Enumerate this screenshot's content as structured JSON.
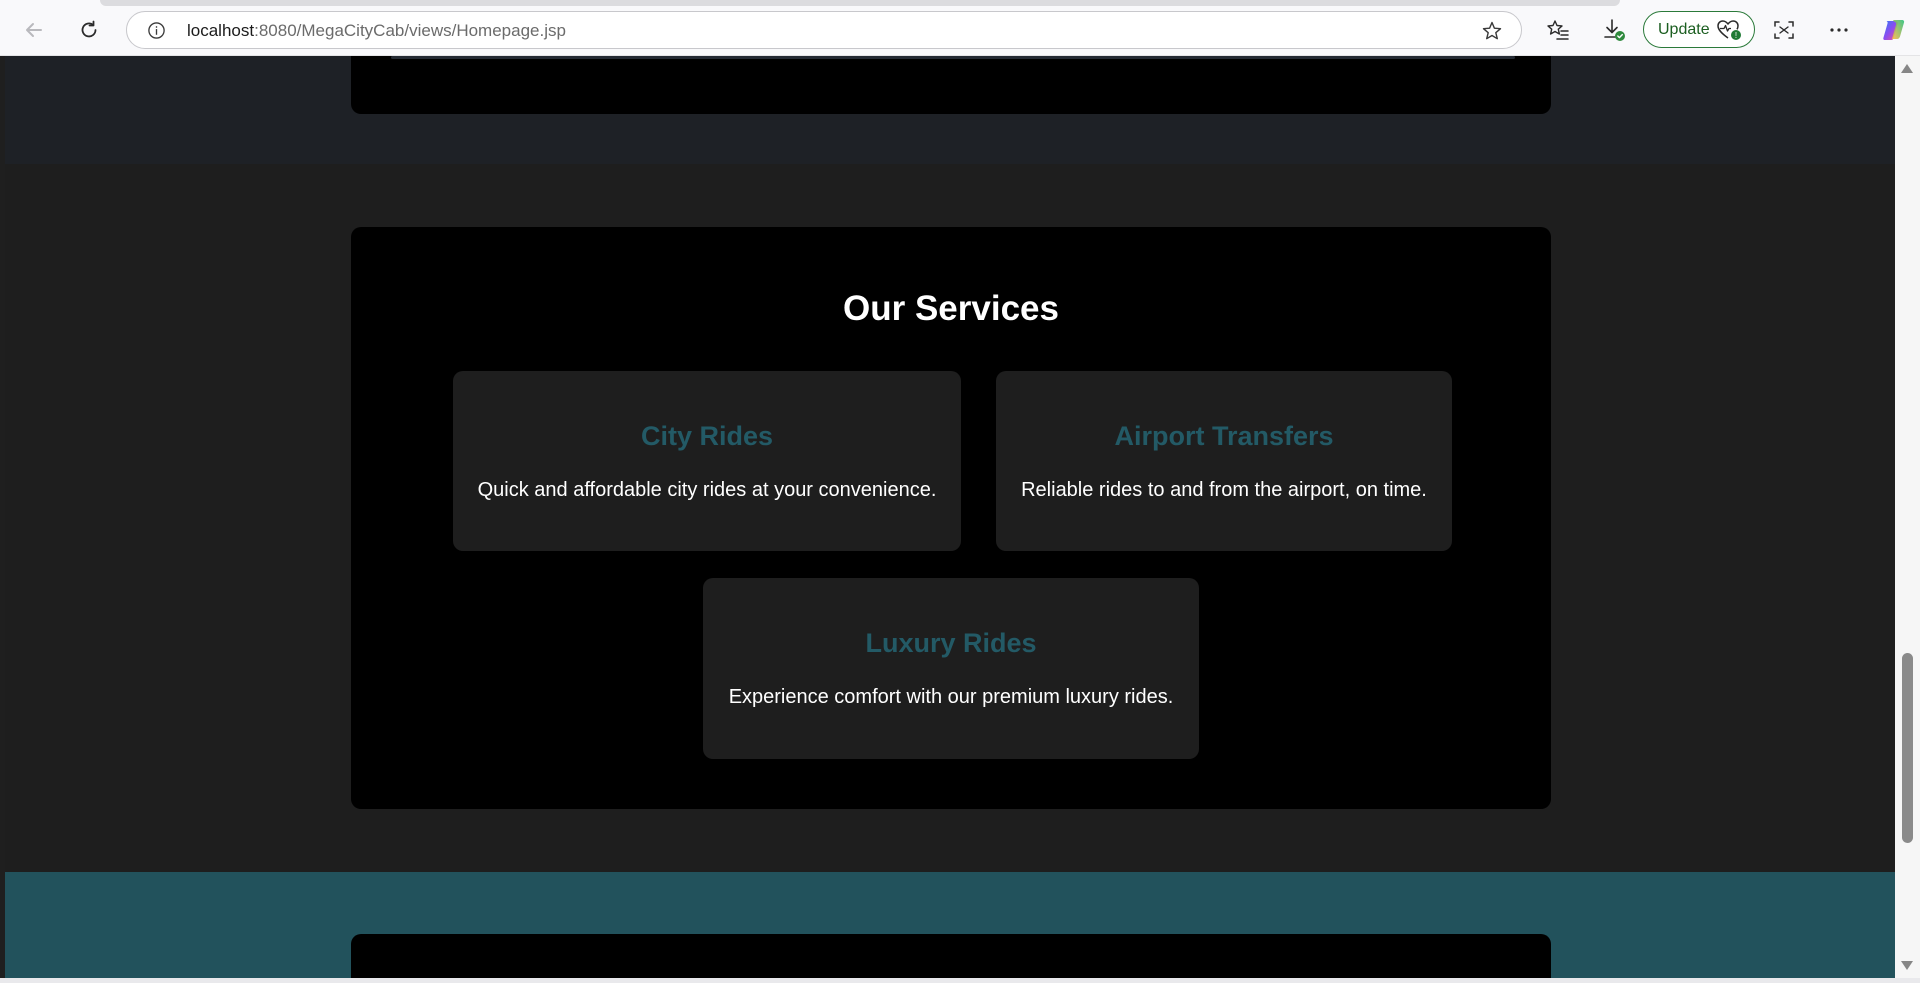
{
  "browser": {
    "url_host": "localhost",
    "url_rest": ":8080/MegaCityCab/views/Homepage.jsp",
    "update_label": "Update",
    "icons": {
      "back": "back-arrow-icon",
      "reload": "reload-icon",
      "site_info": "info-icon",
      "favorite": "star-icon",
      "favorites_list": "favorites-list-icon",
      "downloads": "download-icon",
      "health": "heart-pulse-icon",
      "screenshot": "screenshot-icon",
      "more": "more-dots-icon",
      "copilot": "copilot-icon"
    }
  },
  "services": {
    "title": "Our Services",
    "items": [
      {
        "title": "City Rides",
        "description": "Quick and affordable city rides at your convenience."
      },
      {
        "title": "Airport Transfers",
        "description": "Reliable rides to and from the airport, on time."
      },
      {
        "title": "Luxury Rides",
        "description": "Experience comfort with our premium luxury rides."
      }
    ]
  },
  "colors": {
    "accent": "#235a66",
    "page_bg": "#1e1e1e",
    "card_bg": "#000000",
    "footer_bg": "#22525c"
  }
}
